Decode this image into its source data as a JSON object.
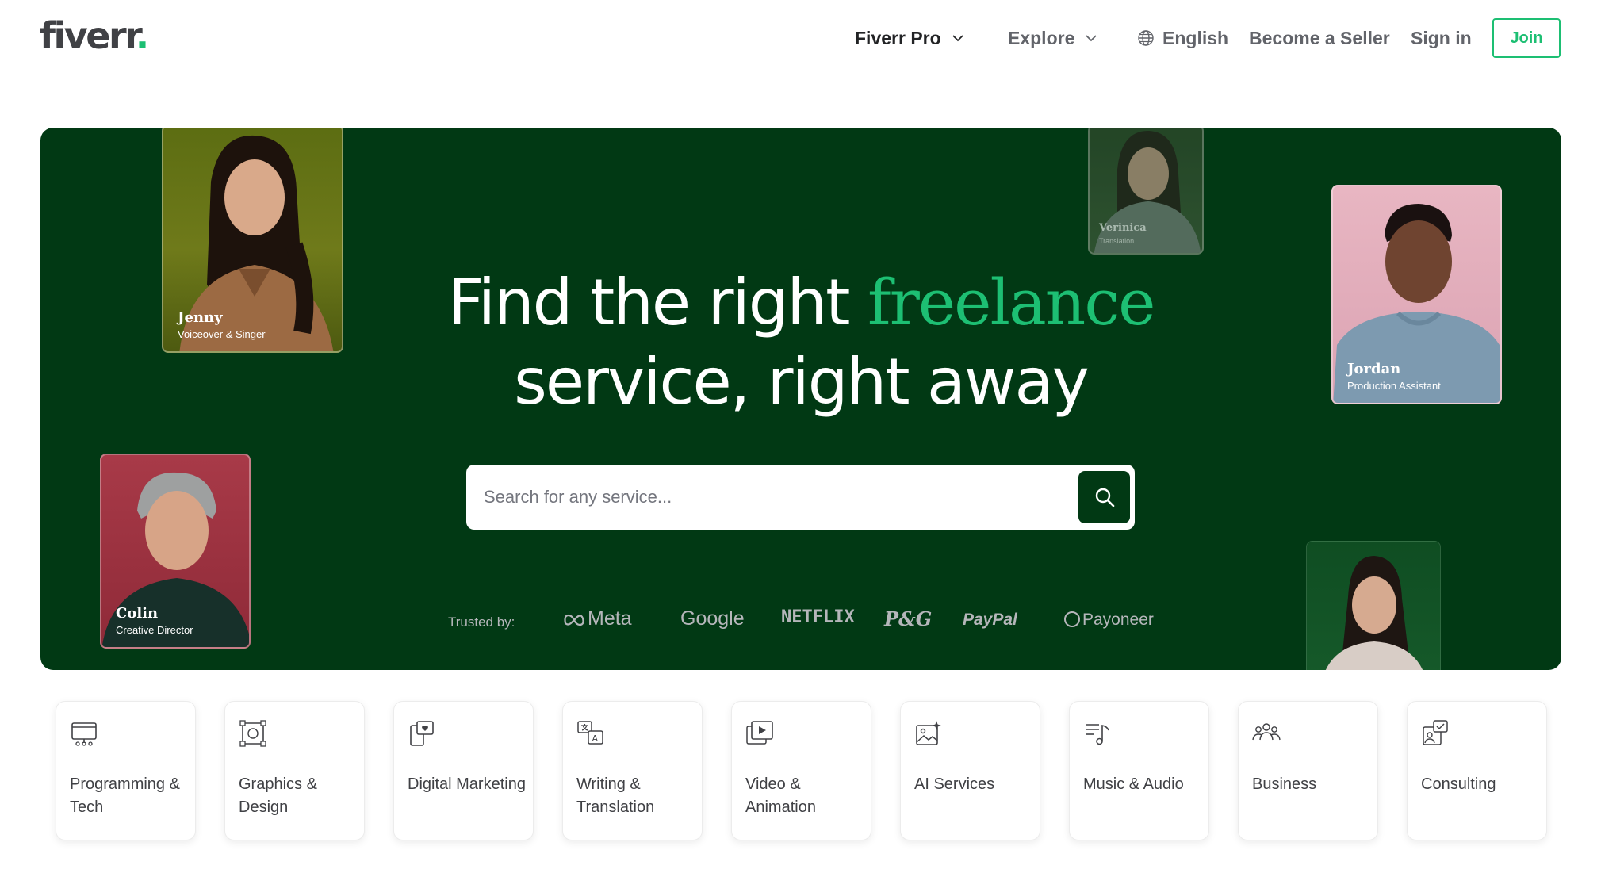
{
  "header": {
    "logo_text": "fiverr",
    "logo_dot": ".",
    "nav": {
      "fiverr_pro": "Fiverr Pro",
      "explore": "Explore",
      "language": "English",
      "become_seller": "Become a Seller",
      "sign_in": "Sign in",
      "join": "Join"
    }
  },
  "hero": {
    "headline_part1": "Find the right ",
    "headline_accent": "freelance",
    "headline_line2": "service, right away",
    "search": {
      "placeholder": "Search for any service..."
    },
    "trusted_label": "Trusted by:",
    "brands": [
      "Meta",
      "Google",
      "NETFLIX",
      "P&G",
      "PayPal",
      "Payoneer"
    ],
    "profiles": [
      {
        "name": "Jenny",
        "role": "Voiceover & Singer"
      },
      {
        "name": "Colin",
        "role": "Creative Director"
      },
      {
        "name": "Verinica",
        "role": "Translation"
      },
      {
        "name": "Jordan",
        "role": "Production Assistant"
      }
    ]
  },
  "categories": [
    {
      "label": "Programming & Tech",
      "icon": "monitor-icon"
    },
    {
      "label": "Graphics & Design",
      "icon": "design-frame-icon"
    },
    {
      "label": "Digital Marketing",
      "icon": "marketing-icon"
    },
    {
      "label": "Writing & Translation",
      "icon": "translate-icon"
    },
    {
      "label": "Video & Animation",
      "icon": "video-play-icon"
    },
    {
      "label": "AI Services",
      "icon": "ai-image-icon"
    },
    {
      "label": "Music & Audio",
      "icon": "music-icon"
    },
    {
      "label": "Business",
      "icon": "people-icon"
    },
    {
      "label": "Consulting",
      "icon": "consulting-icon"
    }
  ],
  "colors": {
    "brand_green": "#1dbf73",
    "hero_background": "#013914",
    "text_dark": "#404145"
  }
}
